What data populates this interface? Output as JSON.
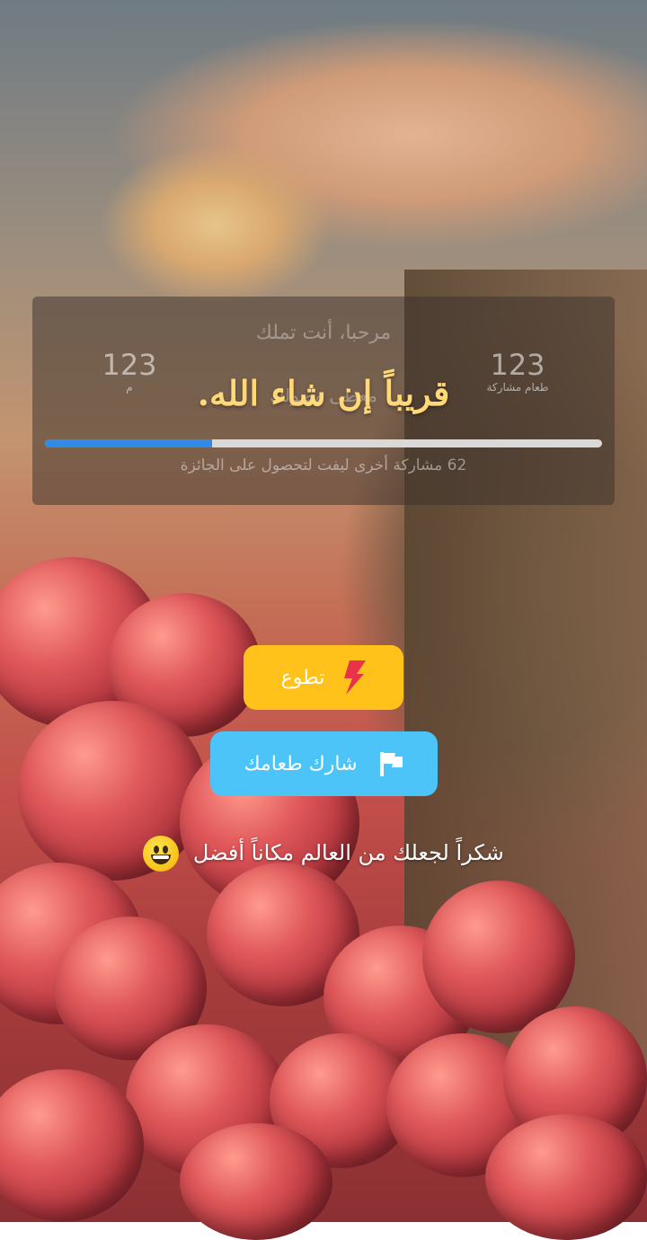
{
  "header": {
    "greeting": "مرحبا، أنت تملك",
    "stat_left_value": "123",
    "stat_left_label": "م",
    "stat_right_value": "123",
    "stat_right_label": "طعام مشاركة",
    "sub_text": "معطى وصولك",
    "headline": "قريباً إن شاء الله."
  },
  "progress": {
    "value": 0.3,
    "text": "62 مشاركة أخرى ليفت لتحصول على الجائزة"
  },
  "actions": {
    "volunteer_label": "تطوع",
    "share_label": "شارك طعامك"
  },
  "footer": {
    "thanks": "شكراً لجعلك من العالم مكاناً أفضل"
  },
  "icons": {
    "volunteer": "lightning-icon",
    "share": "flag-icon",
    "emoji": "grinning-face-icon"
  },
  "colors": {
    "volunteer_button": "#ffc21a",
    "share_button": "#4cc4f7",
    "headline": "#ffd978",
    "progress_fill": "#2f8be6",
    "lightning": "#e8334a"
  }
}
